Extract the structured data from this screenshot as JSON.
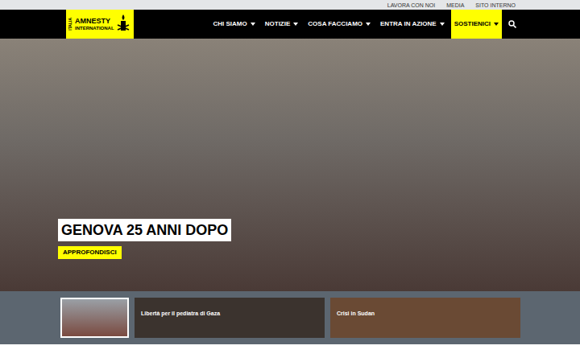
{
  "top_links": [
    "LAVORA CON NOI",
    "MEDIA",
    "SITO INTERNO"
  ],
  "logo": {
    "country": "ITALIA",
    "line1": "AMNESTY",
    "line2": "INTERNATIONAL"
  },
  "nav": [
    {
      "label": "CHI SIAMO",
      "selected": false
    },
    {
      "label": "NOTIZIE",
      "selected": false
    },
    {
      "label": "COSA FACCIAMO",
      "selected": false
    },
    {
      "label": "ENTRA IN AZIONE",
      "selected": false
    },
    {
      "label": "SOSTIENICI",
      "selected": true
    }
  ],
  "hero": {
    "title": "GENOVA 25 ANNI DOPO",
    "button": "APPROFONDISCI"
  },
  "cards": [
    {
      "kind": "thumbnail",
      "title": "",
      "selected": true
    },
    {
      "kind": "story",
      "title": "Libertà per il pediatra di Gaza",
      "selected": false
    },
    {
      "kind": "story",
      "title": "Crisi in Sudan",
      "selected": false
    }
  ]
}
